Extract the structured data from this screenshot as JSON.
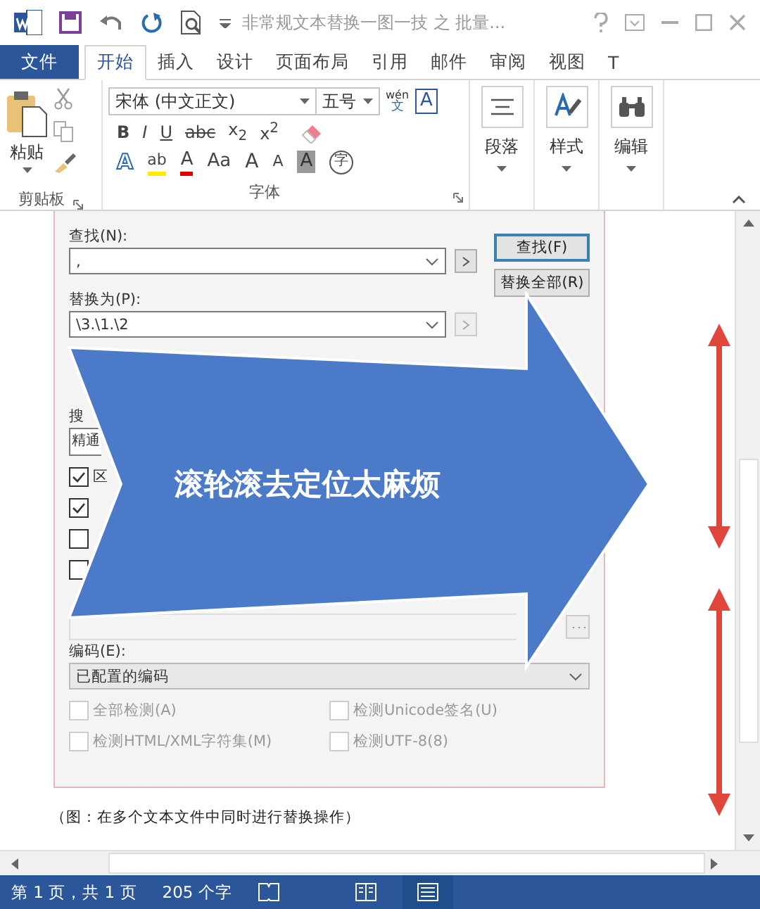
{
  "window": {
    "title": "非常规文本替换一图一技 之 批量..."
  },
  "ribbon": {
    "tabs": [
      {
        "label": "文件",
        "kind": "file",
        "selected": false
      },
      {
        "label": "开始",
        "kind": "tab",
        "selected": true
      },
      {
        "label": "插入",
        "kind": "tab",
        "selected": false
      },
      {
        "label": "设计",
        "kind": "tab",
        "selected": false
      },
      {
        "label": "页面布局",
        "kind": "tab",
        "selected": false
      },
      {
        "label": "引用",
        "kind": "tab",
        "selected": false
      },
      {
        "label": "邮件",
        "kind": "tab",
        "selected": false
      },
      {
        "label": "审阅",
        "kind": "tab",
        "selected": false
      },
      {
        "label": "视图",
        "kind": "tab",
        "selected": false
      },
      {
        "label": "T",
        "kind": "tab",
        "selected": false
      }
    ],
    "clipboard": {
      "paste": "粘贴",
      "group": "剪贴板"
    },
    "font": {
      "name": "宋体 (中文正文)",
      "size": "五号",
      "phonetic_top": "wén",
      "phonetic_bottom": "文",
      "border_char": "A",
      "group": "字体",
      "format_buttons": [
        {
          "label": "B",
          "kind": "bold"
        },
        {
          "label": "I",
          "kind": "italic"
        },
        {
          "label": "U",
          "kind": "underline"
        },
        {
          "label": "abc",
          "kind": "strike"
        },
        {
          "label": "x$_{2}$",
          "kind": "plain"
        },
        {
          "label": "x$^{2}$",
          "kind": "plain"
        }
      ],
      "effect_buttons": [
        {
          "label": "A",
          "kind": "effect"
        },
        {
          "label": "ab",
          "kind": "highlight"
        },
        {
          "label": "A",
          "kind": "color"
        },
        {
          "label": "Aa",
          "kind": "case"
        },
        {
          "label": "A",
          "kind": "grow"
        },
        {
          "label": "A",
          "kind": "shrink"
        },
        {
          "label": "A",
          "kind": "shade"
        },
        {
          "label": "字",
          "kind": "circle"
        }
      ]
    },
    "big_buttons": [
      {
        "label": "段落",
        "kind": "paragraph"
      },
      {
        "label": "样式",
        "kind": "styles"
      },
      {
        "label": "编辑",
        "kind": "editing"
      }
    ]
  },
  "dialog": {
    "find": {
      "label": "查找(N):",
      "value": ","
    },
    "replace": {
      "label": "替换为(P):",
      "value": "\\3.\\1.\\2"
    },
    "buttons": [
      {
        "label": "查找(F)",
        "selected": true
      },
      {
        "label": "替换全部(R)",
        "selected": false
      }
    ],
    "search_label": "搜",
    "search_value": "精通",
    "options": [
      {
        "label": "区",
        "checked": true
      },
      {
        "checked": true
      },
      {
        "checked": false
      },
      {
        "checked": false
      }
    ],
    "encoding": {
      "label": "编码(E):",
      "value": "已配置的编码"
    },
    "detect_options": [
      {
        "label": "全部检测(A)",
        "checked": false,
        "disabled": true
      },
      {
        "label": "检测Unicode签名(U)",
        "checked": false,
        "disabled": true
      },
      {
        "label": "检测HTML/XML字符集(M)",
        "checked": false,
        "disabled": true
      },
      {
        "label": "检测UTF-8(8)",
        "checked": false,
        "disabled": true
      }
    ]
  },
  "arrow_annotation": {
    "text": "滚轮滚去定位太麻烦"
  },
  "document": {
    "caption": "（图：在多个文本文件中同时进行替换操作）"
  },
  "status_bar": {
    "page": "第 1 页，共 1 页",
    "words": "205 个字"
  }
}
